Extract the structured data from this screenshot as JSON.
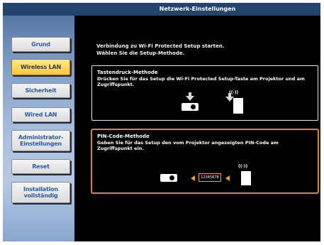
{
  "title_bar": {
    "title": "Netzwerk-Einstellungen"
  },
  "sidebar": {
    "items": [
      {
        "label": "Grund",
        "active": false
      },
      {
        "label": "Wireless LAN",
        "active": true
      },
      {
        "label": "Sicherheit",
        "active": false
      },
      {
        "label": "Wired LAN",
        "active": false
      },
      {
        "label": "Administrator-\nEinstellungen",
        "active": false
      },
      {
        "label": "Reset",
        "active": false
      },
      {
        "label": "Installation\nvollständig",
        "active": false
      }
    ]
  },
  "main": {
    "intro_line1": "Verbindung zu Wi-Fi Protected Setup starten.",
    "intro_line2": "Wählen Sie die Setup-Methode.",
    "push_button": {
      "title": "Tastendruck-Methode",
      "description": "Drücken Sie für das Setup die Wi-Fi Protected Setup-Taste am Projektor und am Zugriffspunkt."
    },
    "pin_code": {
      "title": "PIN-Code-Methode",
      "description": "Geben Sie für das Setup den vom Projektor angezeigten PIN-Code am Zugriffspunkt ein.",
      "pin_value": "12345678"
    },
    "wave_glyph": "((·))"
  },
  "colors": {
    "title_bar": "#23446f",
    "active_item": "#ffc73a",
    "selected_border": "#e69a1e"
  }
}
